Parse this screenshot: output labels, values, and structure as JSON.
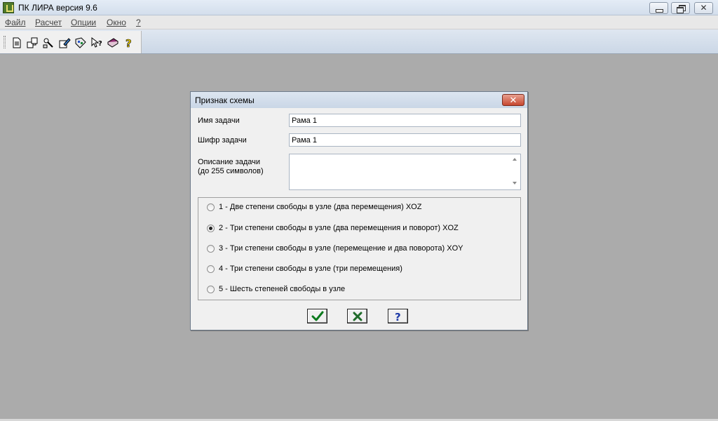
{
  "app": {
    "title": "ПК ЛИРА  версия 9.6",
    "window_controls": {
      "minimize_icon": "minimize-icon",
      "maximize_icon": "restore-icon",
      "close_symbol": "✕"
    }
  },
  "menu": {
    "items": [
      {
        "label": "Файл"
      },
      {
        "label": "Расчет"
      },
      {
        "label": "Опции"
      },
      {
        "label": "Окно"
      },
      {
        "label": "?"
      }
    ]
  },
  "toolbar": {
    "buttons": [
      {
        "icon": "new-document-icon"
      },
      {
        "icon": "open-project-icon"
      },
      {
        "icon": "settings-icon"
      },
      {
        "icon": "edit-icon"
      },
      {
        "icon": "palette-icon"
      },
      {
        "icon": "context-help-icon"
      },
      {
        "icon": "book-icon"
      },
      {
        "icon": "help-icon"
      }
    ]
  },
  "dialog": {
    "title": "Признак схемы",
    "close_symbol": "✕",
    "task_name_label": "Имя задачи",
    "task_name_value": "Рама 1",
    "task_code_label": "Шифр задачи",
    "task_code_value": "Рама 1",
    "description_label_line1": "Описание задачи",
    "description_label_line2": "(до 255 символов)",
    "description_value": "",
    "scheme_options": [
      {
        "label": "1 - Две степени свободы в узле (два перемещения) XOZ",
        "checked": false
      },
      {
        "label": "2 - Три степени свободы в узле (два перемещения и поворот) XOZ",
        "checked": true
      },
      {
        "label": "3 - Три степени свободы в узле (перемещение и два поворота) XOY",
        "checked": false
      },
      {
        "label": "4 - Три степени свободы в узле (три перемещения)",
        "checked": false
      },
      {
        "label": "5 - Шесть степеней свободы в узле",
        "checked": false
      }
    ],
    "buttons": {
      "ok_icon": "checkmark-icon",
      "cancel_icon": "cross-icon",
      "help_icon": "question-icon",
      "help_symbol": "?"
    }
  },
  "colors": {
    "workspace": "#ababab",
    "ok_green": "#0b7a1d",
    "cancel_green": "#1f6b2a",
    "help_blue": "#1e3aa8"
  }
}
